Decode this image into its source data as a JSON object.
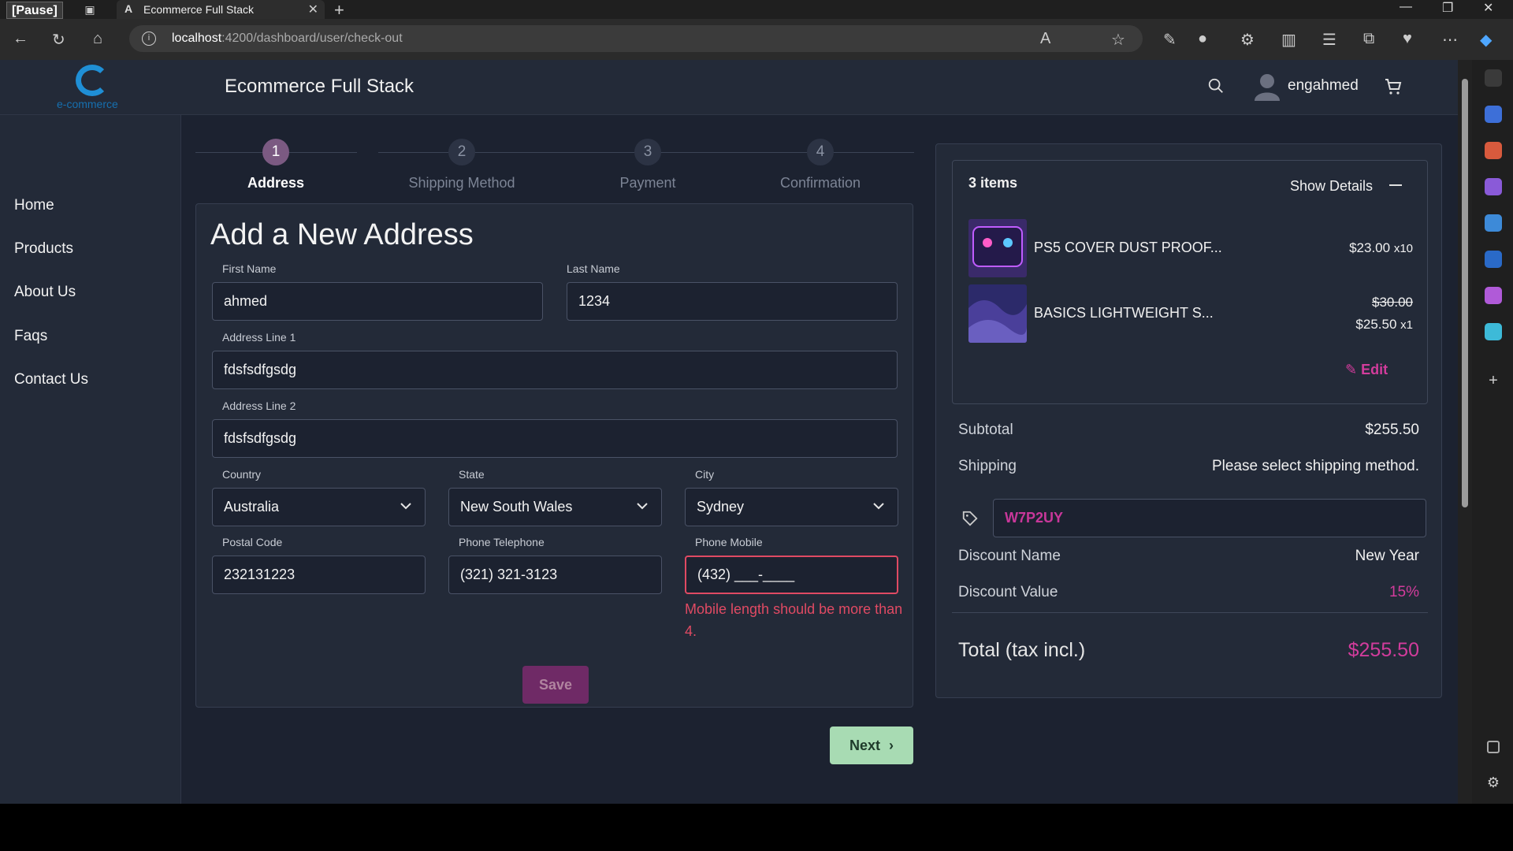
{
  "browser": {
    "pause_badge": "[Pause]",
    "tab_title": "Ecommerce Full Stack",
    "tab_favicon": "A",
    "url_host": "localhost",
    "url_rest": ":4200/dashboard/user/check-out"
  },
  "header": {
    "logo_text": "e-commerce",
    "title": "Ecommerce Full Stack",
    "username": "engahmed"
  },
  "nav": {
    "items": [
      "Home",
      "Products",
      "About Us",
      "Faqs",
      "Contact Us"
    ]
  },
  "stepper": {
    "steps": [
      {
        "num": "1",
        "label": "Address"
      },
      {
        "num": "2",
        "label": "Shipping Method"
      },
      {
        "num": "3",
        "label": "Payment"
      },
      {
        "num": "4",
        "label": "Confirmation"
      }
    ]
  },
  "form": {
    "title": "Add a New Address",
    "first_name_label": "First Name",
    "first_name_value": "ahmed",
    "last_name_label": "Last Name",
    "last_name_value": "1234",
    "address1_label": "Address Line 1",
    "address1_value": "fdsfsdfgsdg",
    "address2_label": "Address Line 2",
    "address2_value": "fdsfsdfgsdg",
    "country_label": "Country",
    "country_value": "Australia",
    "state_label": "State",
    "state_value": "New South Wales",
    "city_label": "City",
    "city_value": "Sydney",
    "postal_label": "Postal Code",
    "postal_value": "232131223",
    "phone_tel_label": "Phone Telephone",
    "phone_tel_value": "(321) 321-3123",
    "phone_mobile_label": "Phone Mobile",
    "phone_mobile_value": "(432) ___-____",
    "mobile_error": "Mobile length should be more than 4.",
    "save_label": "Save",
    "next_label": "Next"
  },
  "summary": {
    "items_count": "3 items",
    "show_details": "Show Details",
    "items": [
      {
        "name": "PS5 COVER DUST PROOF...",
        "price": "$23.00",
        "qty": "x10"
      },
      {
        "name": "BASICS LIGHTWEIGHT S...",
        "old_price": "$30.00",
        "price": "$25.50",
        "qty": "x1"
      }
    ],
    "edit_label": "Edit",
    "subtotal_label": "Subtotal",
    "subtotal_value": "$255.50",
    "shipping_label": "Shipping",
    "shipping_value": "Please select shipping method.",
    "coupon_code": "W7P2UY",
    "discount_name_label": "Discount Name",
    "discount_name_value": "New Year",
    "discount_value_label": "Discount Value",
    "discount_value_value": "15%",
    "total_label": "Total (tax incl.)",
    "total_value": "$255.50"
  },
  "colors": {
    "accent_pink": "#d23c9c",
    "error_red": "#e04a63",
    "next_green": "#a8dbb3",
    "save_purple": "#6f2a66"
  }
}
